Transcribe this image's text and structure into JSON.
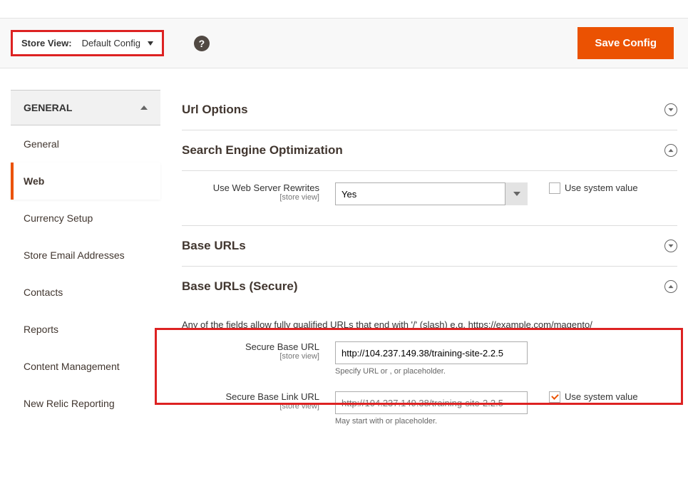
{
  "toolbar": {
    "store_view_label": "Store View:",
    "store_view_value": "Default Config",
    "save_label": "Save Config"
  },
  "sidebar": {
    "section": "GENERAL",
    "items": [
      {
        "label": "General"
      },
      {
        "label": "Web",
        "active": true
      },
      {
        "label": "Currency Setup"
      },
      {
        "label": "Store Email Addresses"
      },
      {
        "label": "Contacts"
      },
      {
        "label": "Reports"
      },
      {
        "label": "Content Management"
      },
      {
        "label": "New Relic Reporting"
      }
    ]
  },
  "sections": {
    "url_options": "Url Options",
    "seo": "Search Engine Optimization",
    "base_urls": "Base URLs",
    "base_urls_secure": "Base URLs (Secure)"
  },
  "seo_row": {
    "label": "Use Web Server Rewrites",
    "scope": "[store view]",
    "value": "Yes",
    "use_system": "Use system value"
  },
  "secure": {
    "desc": "Any of the fields allow fully qualified URLs that end with '/' (slash) e.g. https://example.com/magento/",
    "base_url": {
      "label": "Secure Base URL",
      "scope": "[store view]",
      "value": "http://104.237.149.38/training-site-2.2.5",
      "hint": "Specify URL or , or placeholder."
    },
    "base_link_url": {
      "label": "Secure Base Link URL",
      "scope": "[store view]",
      "placeholder": "http://104.237.149.38/training-site-2.2.5",
      "hint": "May start with or placeholder.",
      "use_system": "Use system value"
    }
  }
}
